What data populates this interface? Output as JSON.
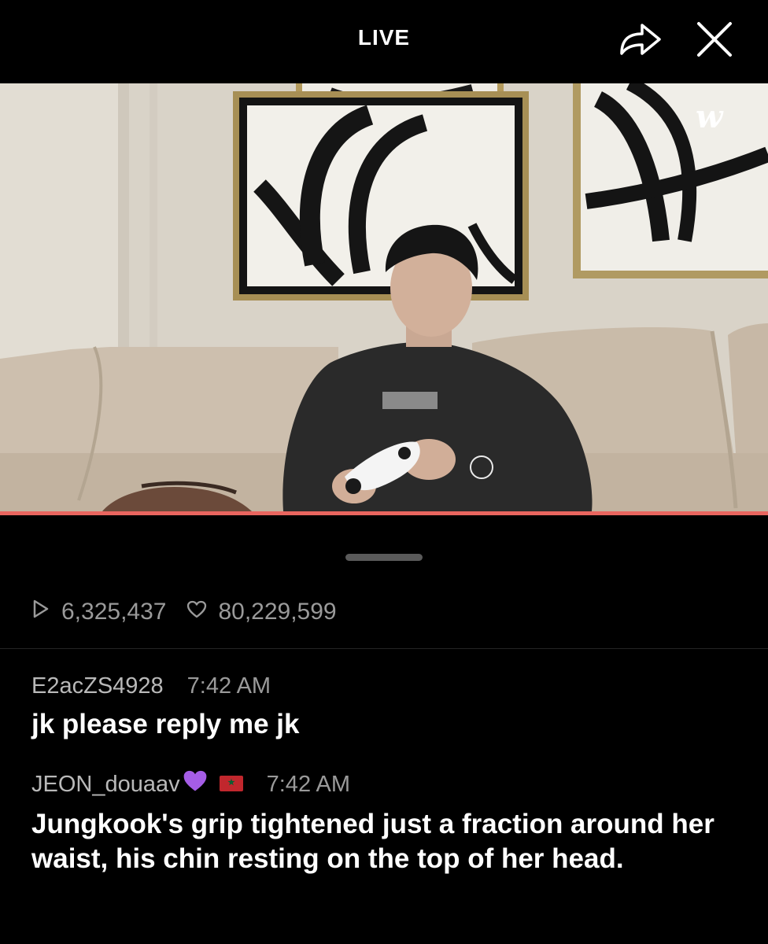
{
  "header": {
    "title": "LIVE",
    "share_icon": "share-icon",
    "close_icon": "close-icon"
  },
  "video": {
    "watermark_icon": "weverse-logo",
    "progress": 1.0,
    "progress_color": "#e9655f"
  },
  "stats": {
    "views_icon": "play-icon",
    "views": "6,325,437",
    "likes_icon": "heart-icon",
    "likes": "80,229,599"
  },
  "comments": [
    {
      "username": "E2acZS4928",
      "time": "7:42 AM",
      "text": "jk please reply me jk"
    },
    {
      "username": "JEON_douaav",
      "emoji": "purple-heart",
      "flag": "morocco-flag",
      "time": "7:42 AM",
      "text": "Jungkook's grip tightened just a fraction around her waist, his chin resting on the top of her head."
    }
  ],
  "colors": {
    "background": "#000000",
    "accent": "#e9655f",
    "muted_text": "#9a9a9a"
  }
}
